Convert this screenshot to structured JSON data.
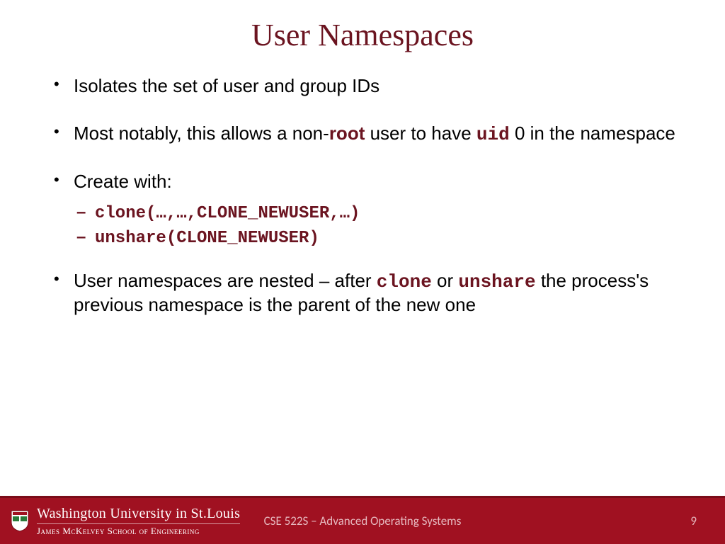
{
  "title": "User Namespaces",
  "bullets": {
    "b1": "Isolates the set of user and group IDs",
    "b2_a": "Most notably, this allows a non-",
    "b2_root": "root",
    "b2_b": " user to have ",
    "b2_uid": "uid",
    "b2_c": " 0 in the namespace",
    "b3": "Create with:",
    "b3_sub1": "clone(…,…,CLONE_NEWUSER,…)",
    "b3_sub2": "unshare(CLONE_NEWUSER)",
    "b4_a": "User namespaces are nested – after ",
    "b4_clone": "clone",
    "b4_b": " or ",
    "b4_unshare": "unshare",
    "b4_c": " the process's previous namespace is the parent of the new one"
  },
  "footer": {
    "university": "Washington University in St.Louis",
    "school": "James McKelvey School of Engineering",
    "course": "CSE 522S – Advanced Operating Systems",
    "page": "9"
  }
}
